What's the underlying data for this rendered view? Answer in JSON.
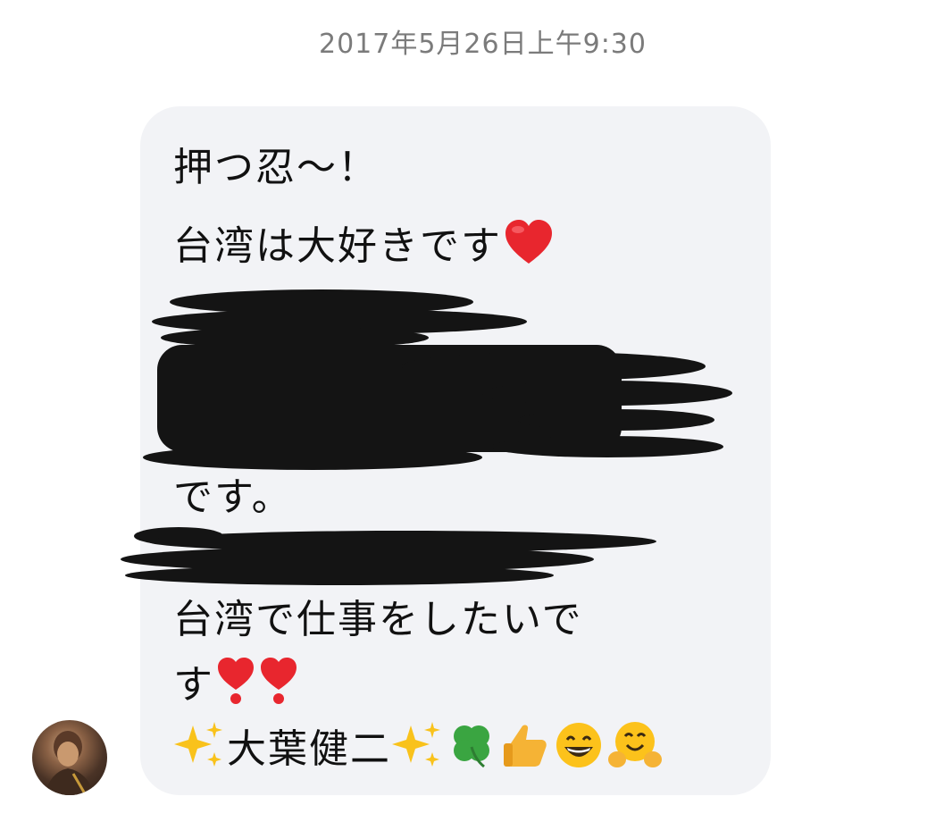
{
  "timestamp": "2017年5月26日上午9:30",
  "message": {
    "lines": [
      "押つ忍～！",
      "台湾は大好きです",
      "です。",
      "台湾で仕事をしたいで",
      "す",
      "大葉健二"
    ],
    "emoji": [
      "red-heart-icon",
      "heavy-exclamation-heart-icon",
      "sparkles-icon",
      "four-leaf-clover-icon",
      "thumbs-up-icon",
      "grinning-face-icon",
      "hugging-face-icon"
    ]
  },
  "colors": {
    "bubble": "#f2f3f6",
    "text": "#111111",
    "timestamp": "#7b7b7b",
    "redaction": "#141414",
    "heart": "#e8262e"
  }
}
